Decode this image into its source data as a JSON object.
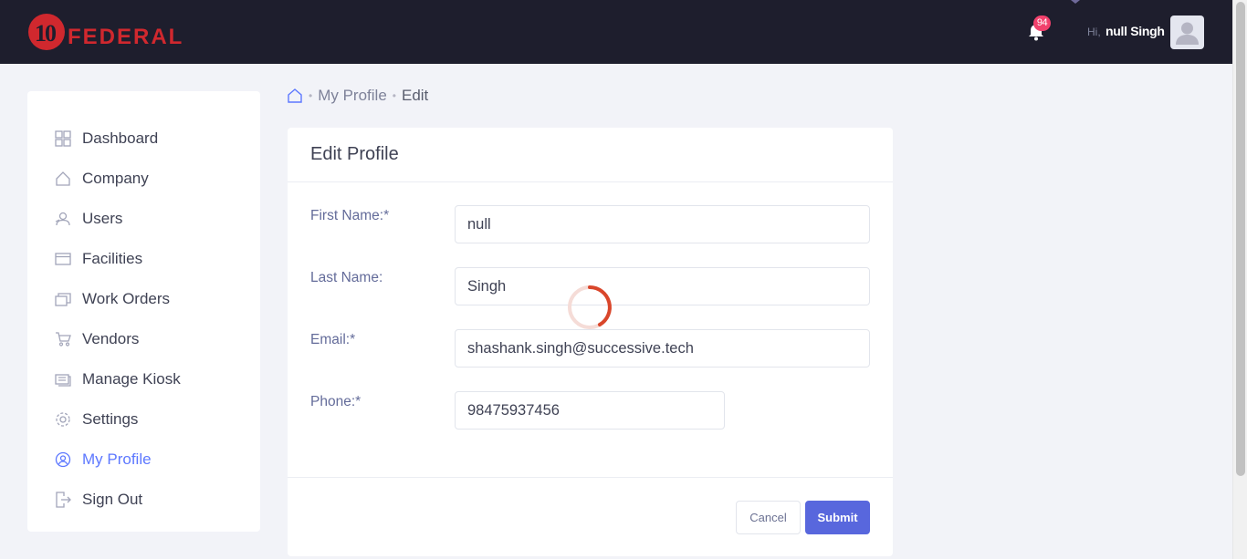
{
  "brand": {
    "logo_number": "10",
    "logo_text": "FEDERAL",
    "logo_color": "#d0282e"
  },
  "header": {
    "notification_count": "94",
    "greeting_prefix": "Hi,",
    "user_name": "null Singh",
    "bar_color": "#1e1e2d"
  },
  "sidebar": {
    "items": [
      {
        "label": "Dashboard",
        "icon": "dashboard-icon",
        "active": false
      },
      {
        "label": "Company",
        "icon": "home-icon",
        "active": false
      },
      {
        "label": "Users",
        "icon": "users-icon",
        "active": false
      },
      {
        "label": "Facilities",
        "icon": "facilities-icon",
        "active": false
      },
      {
        "label": "Work Orders",
        "icon": "work-orders-icon",
        "active": false
      },
      {
        "label": "Vendors",
        "icon": "cart-icon",
        "active": false
      },
      {
        "label": "Manage Kiosk",
        "icon": "kiosk-icon",
        "active": false
      },
      {
        "label": "Settings",
        "icon": "gear-icon",
        "active": false
      },
      {
        "label": "My Profile",
        "icon": "user-circle-icon",
        "active": true
      },
      {
        "label": "Sign Out",
        "icon": "sign-out-icon",
        "active": false
      }
    ],
    "active_color": "#5d78ff"
  },
  "breadcrumb": {
    "items": [
      "My Profile",
      "Edit"
    ]
  },
  "form": {
    "title": "Edit Profile",
    "fields": [
      {
        "label": "First Name:*",
        "value": "null"
      },
      {
        "label": "Last Name:",
        "value": "Singh"
      },
      {
        "label": "Email:*",
        "value": "shashank.singh@successive.tech"
      },
      {
        "label": "Phone:*",
        "value": "98475937456"
      }
    ],
    "cancel_label": "Cancel",
    "submit_label": "Submit",
    "submit_color": "#5867dd"
  }
}
